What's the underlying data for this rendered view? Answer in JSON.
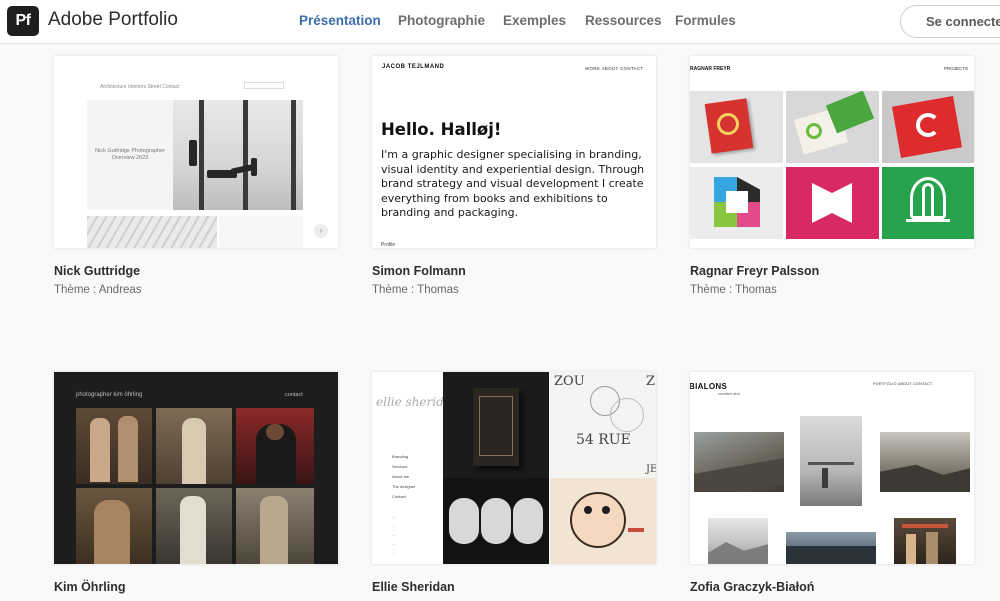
{
  "header": {
    "logo_text": "Pf",
    "brand": "Adobe Portfolio",
    "nav": [
      {
        "label": "Présentation",
        "active": true
      },
      {
        "label": "Photographie",
        "active": false
      },
      {
        "label": "Exemples",
        "active": false
      },
      {
        "label": "Ressources",
        "active": false
      },
      {
        "label": "Formules",
        "active": false
      }
    ],
    "login_label": "Se connecter"
  },
  "colors": {
    "accent": "#3c6eaa",
    "nav_text": "#6e6e6e",
    "background": "#f9f9f9"
  },
  "cards": [
    {
      "name": "Nick Guttridge",
      "theme": "Thème : Andreas",
      "preview": {
        "nav": "Architecture   Interiors   Street   Contact",
        "caption": "Nick Guttridge Photographer Overview 2023"
      }
    },
    {
      "name": "Simon Folmann",
      "theme": "Thème : Thomas",
      "preview": {
        "logo": "JACOB TEJLMAND",
        "nav": "WORK   ABOUT   CONTACT",
        "heading": "Hello. Halløj!",
        "body": "I'm a graphic designer specialising in branding, visual identity and experiential design. Through brand strategy and visual development I create everything from books and exhibitions to branding and packaging.",
        "footer": "Profile"
      }
    },
    {
      "name": "Ragnar Freyr Palsson",
      "theme": "Thème : Thomas",
      "preview": {
        "logo": "RAGNAR FREYR",
        "nav": "PROJECTS"
      }
    },
    {
      "name": "Kim Öhrling",
      "theme": "",
      "preview": {
        "title": "photographer kim öhrling",
        "nav": "contact"
      }
    },
    {
      "name": "Ellie Sheridan",
      "theme": "",
      "preview": {
        "signature": "ellie sheridan",
        "menu": [
          "Branding",
          "Services",
          "About me",
          "The designer",
          "Contact"
        ],
        "zou": "ZOU",
        "z": "Z",
        "rue": "54 RUE",
        "je": "JE"
      }
    },
    {
      "name": "Zofia Graczyk-Białoń",
      "theme": "",
      "preview": {
        "logo": "BIALONS",
        "subtitle": "creative duo",
        "nav": "PORTFOLIO   ABOUT   CONTACT"
      }
    }
  ]
}
